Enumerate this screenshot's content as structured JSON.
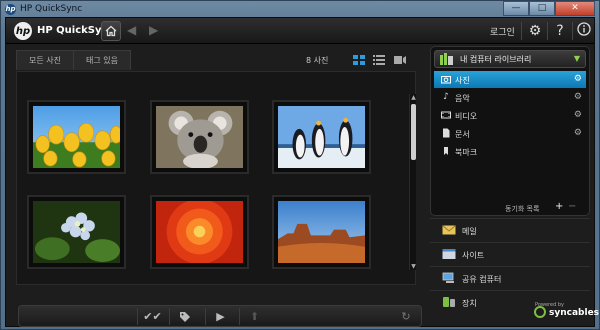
{
  "window": {
    "title": "HP QuickSync",
    "controls": {
      "minimize": "—",
      "maximize": "□",
      "close": "✕"
    }
  },
  "topbar": {
    "logo": "hp",
    "brand": "HP QuickSync",
    "login": "로그인",
    "icons": [
      "home-icon",
      "back-arrow-icon",
      "forward-arrow-icon",
      "gear-icon",
      "help-icon",
      "info-icon"
    ]
  },
  "gallery": {
    "tabs": [
      {
        "label": "모든 사진"
      },
      {
        "label": "태그 있음"
      }
    ],
    "count_label": "8 사진",
    "photos": [
      {
        "subject": "tulips"
      },
      {
        "subject": "koala"
      },
      {
        "subject": "penguins"
      },
      {
        "subject": "hydrangea"
      },
      {
        "subject": "chrysanthemum"
      },
      {
        "subject": "desert"
      }
    ],
    "actions": [
      "check-all-icon",
      "tag-icon",
      "play-icon",
      "upload-icon",
      "refresh-icon"
    ]
  },
  "library": {
    "header": "내 컴퓨터 라이브러리",
    "items": [
      {
        "label": "사진",
        "icon": "camera-icon",
        "selected": true,
        "has_settings": true
      },
      {
        "label": "음악",
        "icon": "music-note-icon",
        "selected": false,
        "has_settings": true
      },
      {
        "label": "비디오",
        "icon": "film-icon",
        "selected": false,
        "has_settings": true
      },
      {
        "label": "문서",
        "icon": "document-icon",
        "selected": false,
        "has_settings": true
      },
      {
        "label": "북마크",
        "icon": "bookmark-icon",
        "selected": false,
        "has_settings": false
      }
    ],
    "sync_list_label": "동기화 목록",
    "add": "+",
    "remove": "−"
  },
  "categories": [
    {
      "label": "메일",
      "icon": "mail-icon"
    },
    {
      "label": "사이트",
      "icon": "site-icon"
    },
    {
      "label": "공유 컴퓨터",
      "icon": "shared-computer-icon"
    },
    {
      "label": "장치",
      "icon": "device-icon"
    }
  ],
  "footer": {
    "powered_by": "Powered by",
    "brand": "syncables"
  },
  "colors": {
    "accent": "#1a8fd0",
    "background": "#1d1d1d",
    "sync_green": "#7bc043"
  }
}
